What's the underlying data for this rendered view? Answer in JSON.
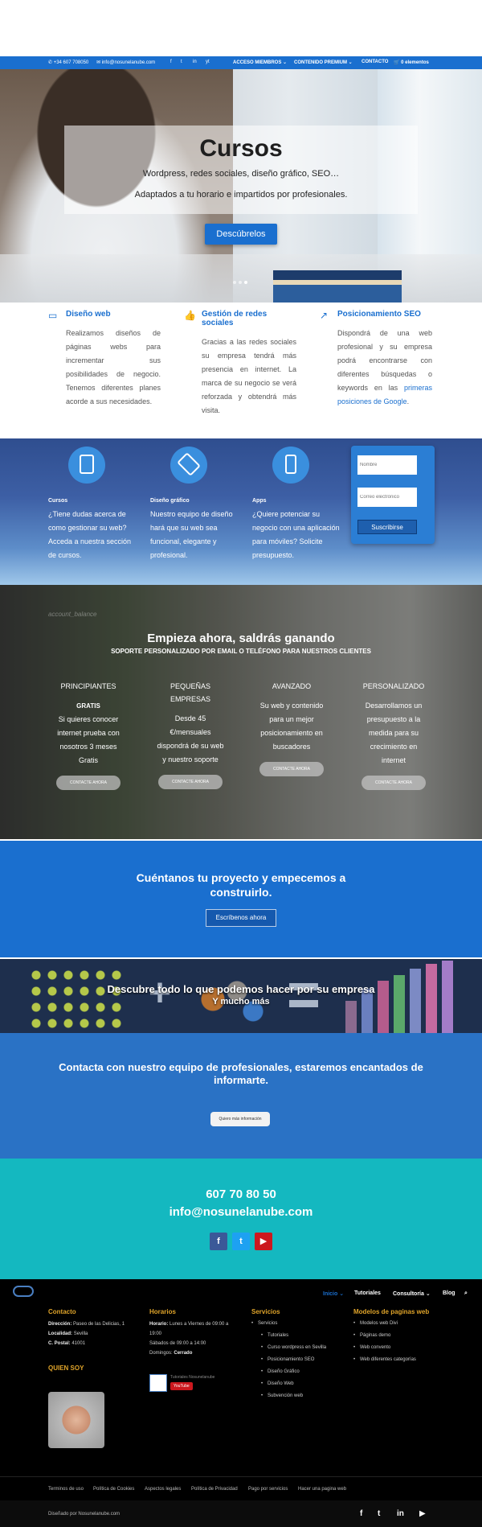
{
  "topbar": {
    "phone": "+34 607 708050",
    "email": "info@nosunelanube.com",
    "social_icons": [
      "f",
      "t",
      "in",
      "yt"
    ],
    "menu": [
      "ACCESO MIEMBROS",
      "CONTENIDO PREMIUM",
      "CONTACTO"
    ],
    "cart": "0 elementos"
  },
  "hero": {
    "title": "Cursos",
    "subtitle1": "Wordpress, redes sociales, diseño gráfico, SEO…",
    "subtitle2": "Adaptados a tu horario e impartidos por profesionales.",
    "cta": "Descúbrelos"
  },
  "features": [
    {
      "icon": "monitor-icon",
      "title": "Diseño web",
      "text": "Realizamos diseños de páginas webs para incrementar sus posibilidades de negocio. Tenemos diferentes planes acorde a sus necesidades."
    },
    {
      "icon": "thumbs-up-icon",
      "title": "Gestión de redes sociales",
      "text": "Gracias a las redes sociales su empresa tendrá más presencia en internet. La marca de su negocio se verá reforzada y obtendrá más visita."
    },
    {
      "icon": "arrow-up-right-icon",
      "title": "Posicionamiento SEO",
      "text": "Dispondrá de una web profesional y su empresa podrá encontrarse con diferentes búsquedas o keywords en las ",
      "link": "primeras posiciones de Google",
      "end": "."
    }
  ],
  "services": [
    {
      "icon": "tablet-icon",
      "title": "Cursos",
      "text": "¿Tiene dudas acerca de como gestionar su web? Acceda a nuestra sección de cursos."
    },
    {
      "icon": "pen-tool-icon",
      "title": "Diseño gráfico",
      "text": "Nuestro equipo de diseño hará que su web sea funcional, elegante y profesional."
    },
    {
      "icon": "smartphone-icon",
      "title": "Apps",
      "text": "¿Quiere potenciar su negocio con una aplicación para móviles? Solicite presupuesto."
    }
  ],
  "subscribe": {
    "name_placeholder": "Nombre",
    "email_placeholder": "Correo electrónico",
    "button": "Suscribirse"
  },
  "pricing": {
    "watermark": "account_balance",
    "title": "Empieza ahora, saldrás ganando",
    "subtitle": "SOPORTE PERSONALIZADO POR EMAIL O TELÉFONO PARA NUESTROS CLIENTES",
    "plans": [
      {
        "name": "PRINCIPIANTES",
        "tag": "GRATIS",
        "text": "Si quieres conocer internet prueba con nosotros 3 meses Gratis",
        "button": "CONTACTE AHORA"
      },
      {
        "name": "PEQUEÑAS EMPRESAS",
        "tag": "",
        "text": "Desde 45 €/mensuales dispondrá de su web y nuestro soporte",
        "button": "CONTACTE AHORA"
      },
      {
        "name": "AVANZADO",
        "tag": "",
        "text": "Su web y contenido para un mejor posicionamiento en buscadores",
        "button": "CONTACTE AHORA"
      },
      {
        "name": "PERSONALIZADO",
        "tag": "",
        "text": "Desarrollamos un presupuesto a la medida para su crecimiento en internet",
        "button": "CONTACTE AHORA"
      }
    ]
  },
  "cuentanos": {
    "title": "Cuéntanos tu proyecto y empecemos a construirlo.",
    "button": "Escríbenos ahora"
  },
  "descubre": {
    "line1": "Descubre todo lo que podemos hacer por su empresa",
    "line2": "Y mucho más"
  },
  "contacta": {
    "title": "Contacta con nuestro equipo de profesionales, estaremos encantados de informarte.",
    "button": "Quiero más información"
  },
  "teal": {
    "phone": "607 70 80 50",
    "email": "info@nosunelanube.com",
    "social": [
      {
        "label": "f",
        "color": "#3b5998"
      },
      {
        "label": "t",
        "color": "#1da1f2"
      },
      {
        "label": "▶",
        "color": "#cc181e"
      }
    ]
  },
  "footer": {
    "nav": [
      "Inicio ⌄",
      "Tutoriales",
      "Consultoría ⌄",
      "Blog",
      "⌕"
    ],
    "contacto": {
      "heading": "Contacto",
      "dir_label": "Dirección:",
      "dir": "Paseo de las Delicias, 1",
      "loc_label": "Localidad:",
      "loc": "Sevilla",
      "cp_label": "C. Postal:",
      "cp": "41001"
    },
    "horarios": {
      "heading": "Horarios",
      "h_label": "Horario:",
      "h": "Lunes a Viernes de 09:00 a 19:00",
      "sab": "Sábados de 09:00 a 14:00",
      "dom_label": "Domingos:",
      "dom": "Cerrado",
      "yt_channel": "Tutoriales Nosunelanube",
      "yt_button": "YouTube"
    },
    "servicios": {
      "heading": "Servicios",
      "items": [
        "Servicios",
        "Tutoriales",
        "Curso wordpress en Sevilla",
        "Posicionamiento SEO",
        "Diseño Gráfico",
        "Diseño Web",
        "Subvención web"
      ]
    },
    "modelos": {
      "heading": "Modelos de paginas web",
      "items": [
        "Modelos web Divi",
        "Páginas demo",
        "Web convento",
        "Web diferentes categorías"
      ]
    },
    "quien": "QUIEN SOY",
    "links": [
      "Terminos de uso",
      "Política de Cookies",
      "Aspectos legales",
      "Política de Privacidad",
      "Pago por servicios",
      "Hacer una pagina web"
    ],
    "credit": "Diseñado por Nosunelanube.com",
    "bottom_icons": [
      "f",
      "t",
      "in",
      "▶"
    ]
  }
}
